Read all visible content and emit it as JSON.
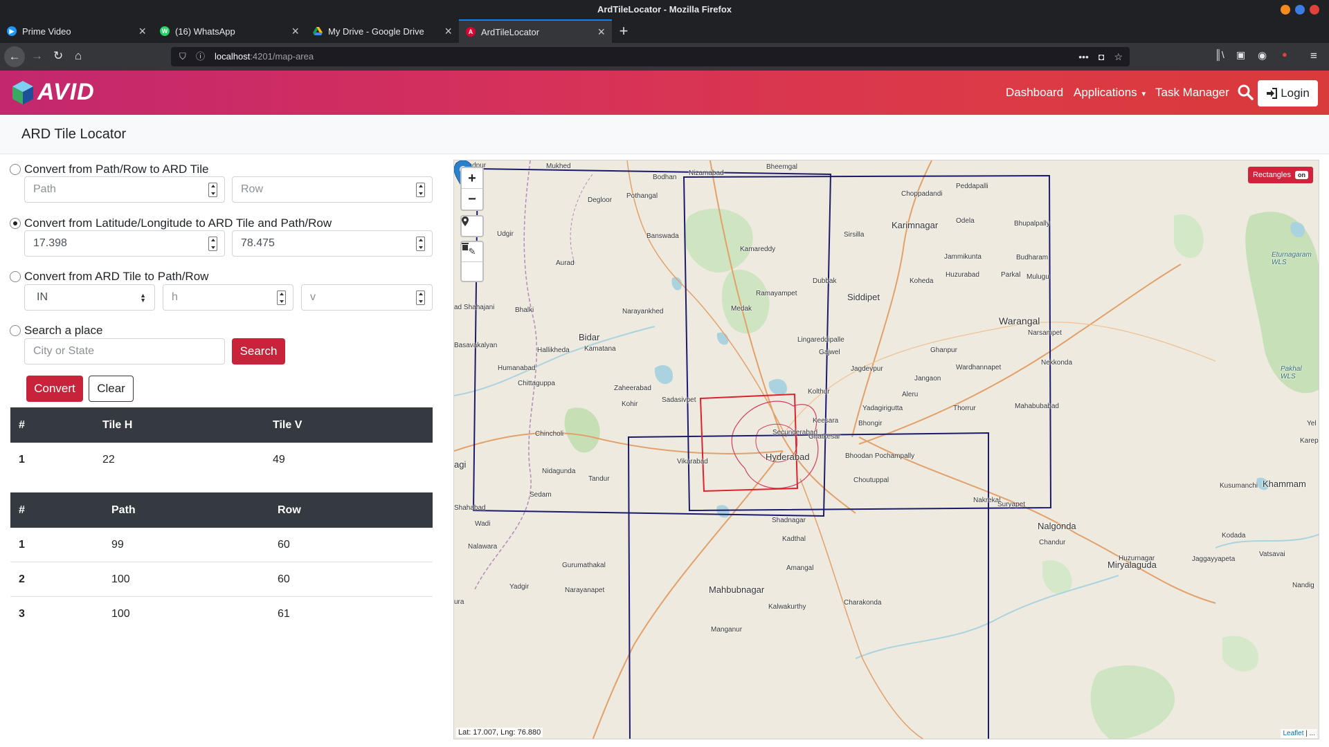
{
  "browser": {
    "window_title": "ArdTileLocator - Mozilla Firefox",
    "tabs": [
      {
        "title": "Prime Video",
        "active": false
      },
      {
        "title": "(16) WhatsApp",
        "active": false
      },
      {
        "title": "My Drive - Google Drive",
        "active": false
      },
      {
        "title": "ArdTileLocator",
        "active": true
      }
    ],
    "url_host": "localhost",
    "url_path": ":4201/map-area"
  },
  "header": {
    "logo_text": "AVID",
    "nav": {
      "dashboard": "Dashboard",
      "applications": "Applications",
      "task_manager": "Task Manager"
    },
    "login_label": "Login"
  },
  "page": {
    "title": "ARD Tile Locator"
  },
  "form": {
    "option1": {
      "label": "Convert from Path/Row to ARD Tile",
      "checked": false,
      "path_placeholder": "Path",
      "row_placeholder": "Row"
    },
    "option2": {
      "label": "Convert from Latitude/Longitude to ARD Tile and Path/Row",
      "checked": true,
      "lat_value": "17.398",
      "lng_value": "78.475"
    },
    "option3": {
      "label": "Convert from ARD Tile to Path/Row",
      "checked": false,
      "region_selected": "IN",
      "h_placeholder": "h",
      "v_placeholder": "v"
    },
    "option4": {
      "label": "Search a place",
      "checked": false,
      "place_placeholder": "City or State",
      "search_label": "Search"
    },
    "convert_label": "Convert",
    "clear_label": "Clear"
  },
  "tile_table": {
    "headers": [
      "#",
      "Tile H",
      "Tile V"
    ],
    "rows": [
      [
        "1",
        "22",
        "49"
      ]
    ]
  },
  "pathrow_table": {
    "headers": [
      "#",
      "Path",
      "Row"
    ],
    "rows": [
      [
        "1",
        "99",
        "60"
      ],
      [
        "2",
        "100",
        "60"
      ],
      [
        "3",
        "100",
        "61"
      ]
    ]
  },
  "map": {
    "zoom_in": "+",
    "zoom_out": "−",
    "rectangles_label": "Rectangles",
    "rectangles_state": "on",
    "coordinates": "Lat: 17.007, Lng: 76.880",
    "attribution": "Leaflet",
    "attribution_suffix": " | ...",
    "places": [
      "Ahmadpur",
      "Mukhed",
      "Bodhan",
      "Nizamabad",
      "Bheemgal",
      "Peddapalli",
      "Degloor",
      "Pothangal",
      "Choppadandi",
      "Udgir",
      "Banswada",
      "Sirsilla",
      "Karimnagar",
      "Odela",
      "Bhupalpally",
      "Aurad",
      "Kamareddy",
      "Jammikunta",
      "Budharam",
      "Huzurabad",
      "Parkal",
      "Mulugu",
      "Ramayampet",
      "Dubbak",
      "Koheda",
      "Siddipet",
      "ad Shahajani",
      "Bhalki",
      "Narayankhed",
      "Medak",
      "Warangal",
      "Narsampet",
      "Bidar",
      "Lingareddipalle",
      "Ghanpur",
      "Basavakalyan",
      "Hallikheda",
      "Kamatana",
      "Gajwel",
      "Jagdevpur",
      "Wardhannapet",
      "Nekkonda",
      "Humanabad",
      "Jangaon",
      "Chittaguppa",
      "Zaheerabad",
      "Kolthur",
      "Aleru",
      "Kohir",
      "Sadasivpet",
      "Yadagirigutta",
      "Thorrur",
      "Mahabubabad",
      "Keesara",
      "Bhongir",
      "Chincholi",
      "Secunderabad",
      "Ghatkesar",
      "Vikarabad",
      "Hyderabad",
      "Bhoodan Pochampally",
      "Nidagunda",
      "Tandur",
      "Choutuppal",
      "Kusumanchi",
      "Khammam",
      "Sedam",
      "Nakrekal",
      "Suryapet",
      "Shahabad",
      "Shadnagar",
      "Wadi",
      "Nalgonda",
      "Kodada",
      "Nalawara",
      "Kadthal",
      "Chandur",
      "Huzurnagar",
      "Jaggayyapeta",
      "Vatsavai",
      "Gurumathakal",
      "Amangal",
      "Miryalaguda",
      "Yadgir",
      "Narayanapet",
      "Mahbubnagar",
      "Kalwakurthy",
      "Charakonda",
      "Nandig",
      "Manganur",
      "agi",
      "ura",
      "Yel",
      "Karepa",
      "Pakhal WLS",
      "Eturnagaram WLS"
    ]
  },
  "colors": {
    "header_gradient_start": "#c3276e",
    "header_gradient_end": "#d93a3a",
    "primary_red": "#c8233a",
    "table_header_bg": "#343a40",
    "tile_rect_stroke": "#1a1a6e",
    "selected_rect_stroke": "#e0202a",
    "marker_blue": "#2a81cb"
  },
  "icons": {
    "search": "search-icon",
    "login": "sign-in-icon",
    "marker": "map-marker-icon",
    "edit": "edit-icon",
    "delete": "trash-icon"
  }
}
